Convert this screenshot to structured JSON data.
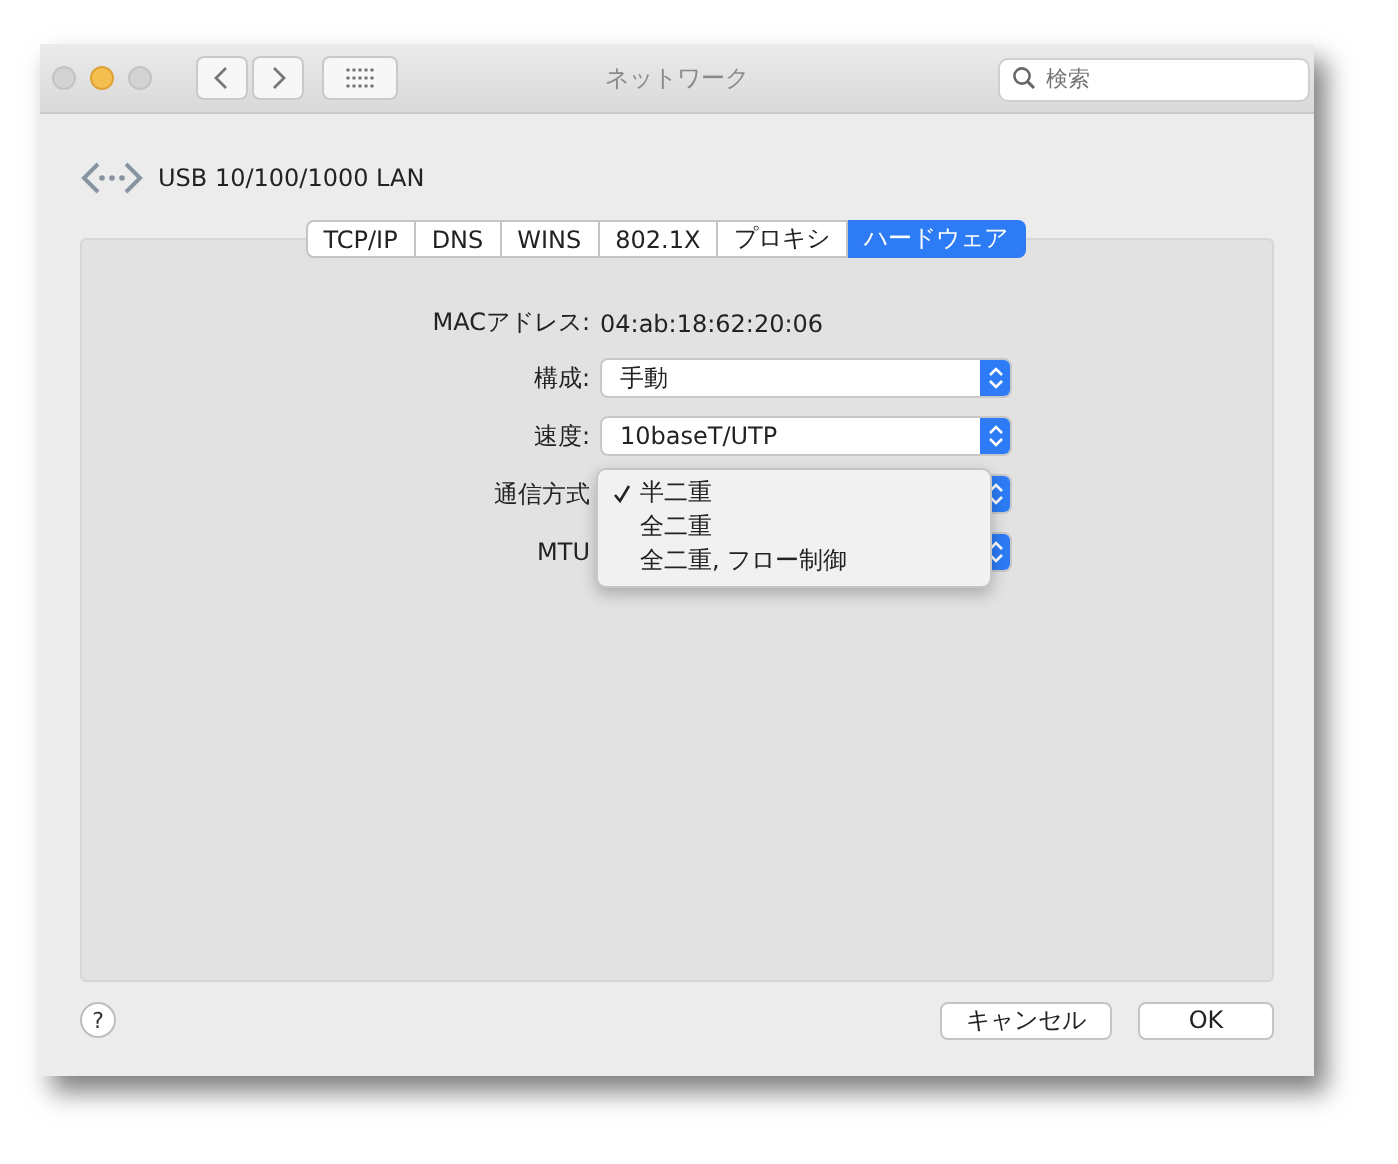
{
  "window": {
    "title": "ネットワーク"
  },
  "search": {
    "placeholder": "検索"
  },
  "interface": {
    "name": "USB 10/100/1000 LAN"
  },
  "tabs": [
    {
      "label": "TCP/IP",
      "selected": false
    },
    {
      "label": "DNS",
      "selected": false
    },
    {
      "label": "WINS",
      "selected": false
    },
    {
      "label": "802.1X",
      "selected": false
    },
    {
      "label": "プロキシ",
      "selected": false
    },
    {
      "label": "ハードウェア",
      "selected": true
    }
  ],
  "fields": [
    {
      "kind": "text",
      "label": "MACアドレス:",
      "value": "04:ab:18:62:20:06"
    },
    {
      "kind": "select",
      "label": "構成:",
      "value": "手動"
    },
    {
      "kind": "select",
      "label": "速度:",
      "value": "10baseT/UTP"
    },
    {
      "kind": "select",
      "label": "通信方式"
    },
    {
      "kind": "select",
      "label": "MTU"
    }
  ],
  "menu": {
    "items": [
      {
        "label": "半二重",
        "checked": true
      },
      {
        "label": "全二重",
        "checked": false
      },
      {
        "label": "全二重, フロー制御",
        "checked": false
      }
    ]
  },
  "help": {
    "label": "?"
  },
  "buttons": [
    {
      "label": "キャンセル"
    },
    {
      "label": "OK"
    }
  ]
}
